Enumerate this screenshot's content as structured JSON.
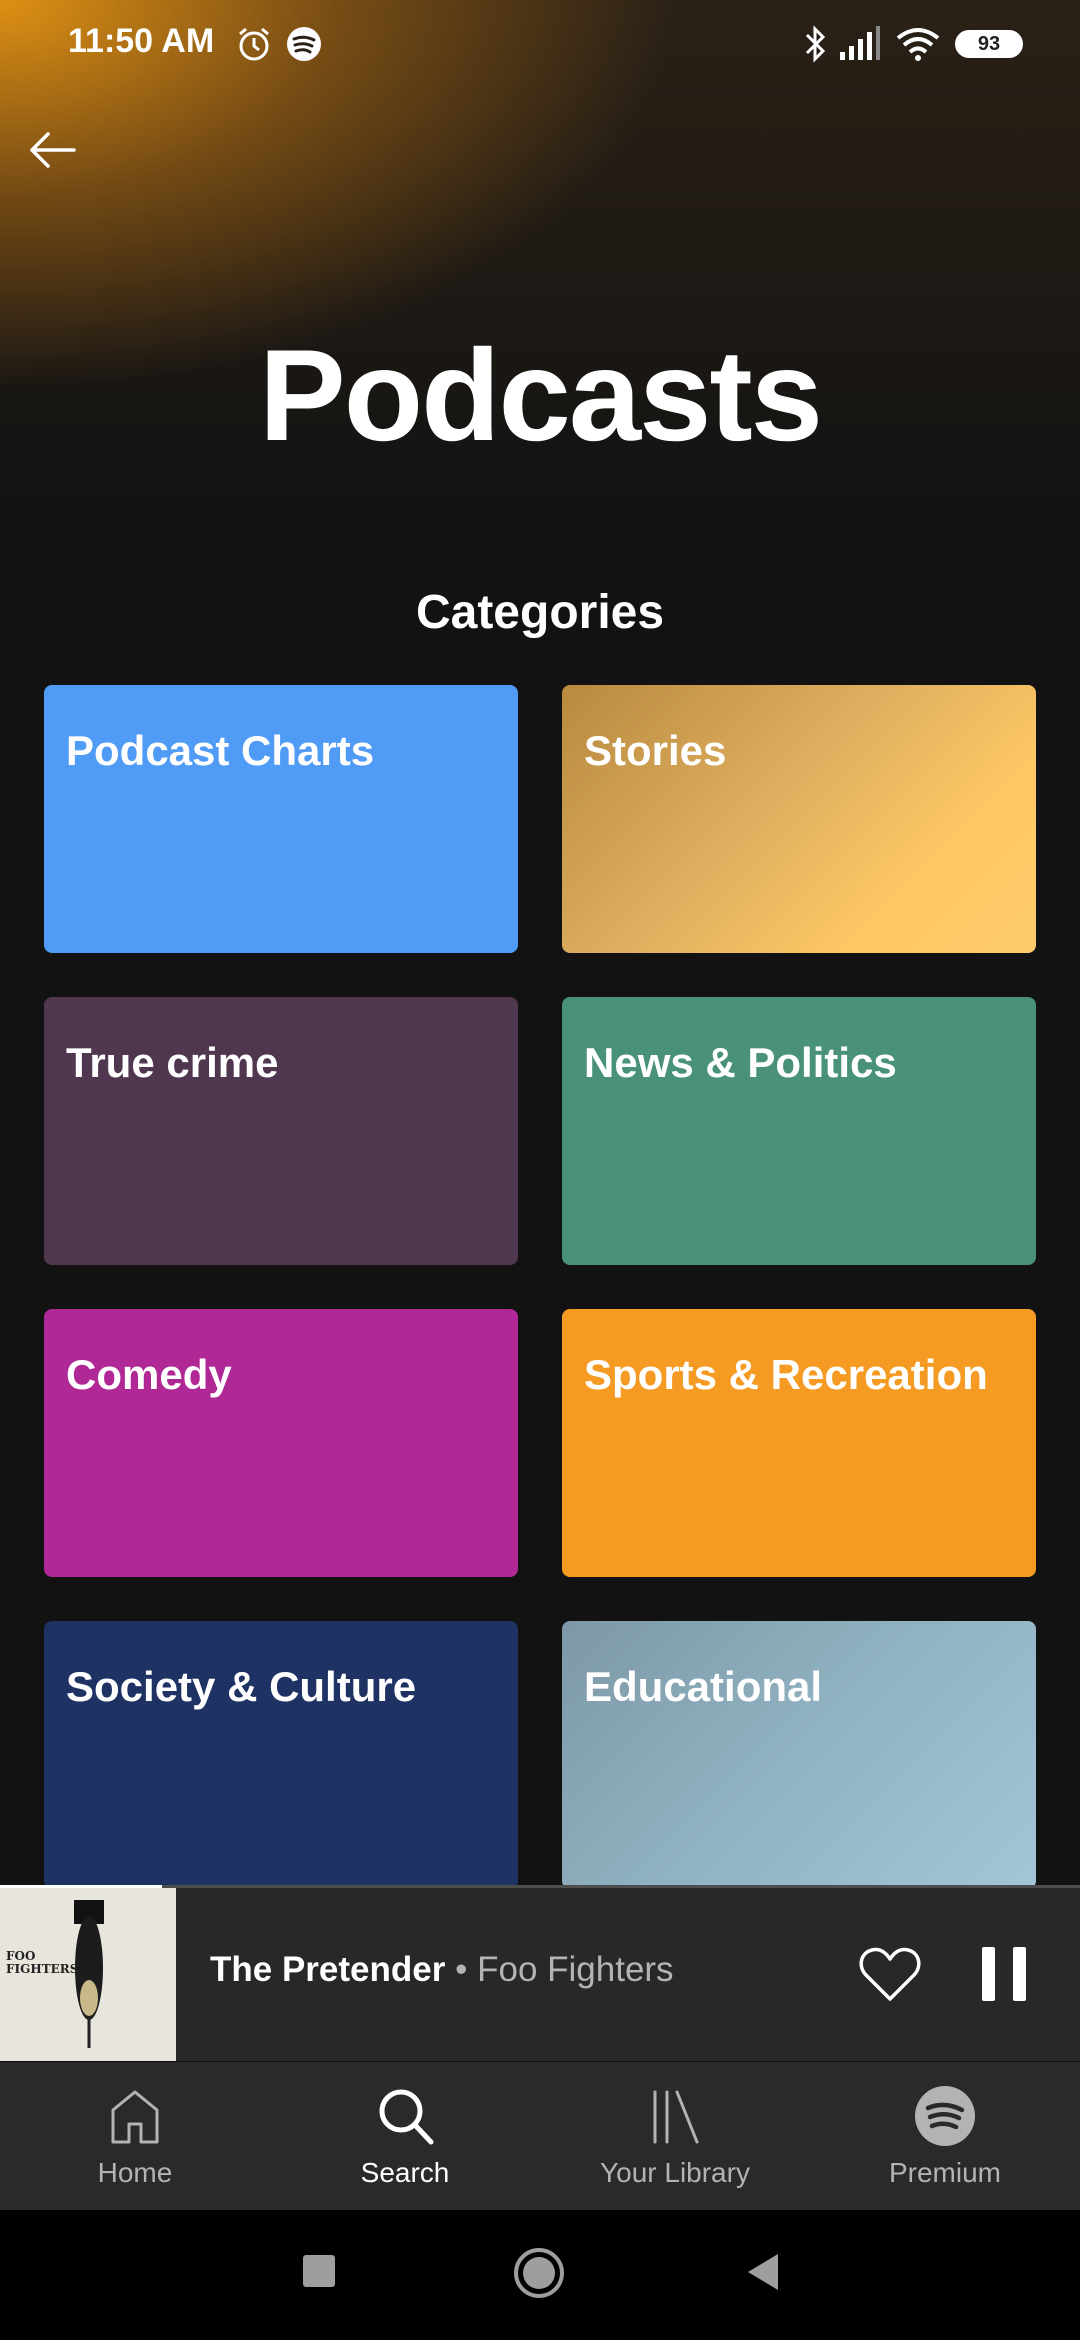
{
  "status_bar": {
    "time": "11:50 AM",
    "battery": "93",
    "icons": [
      "alarm-icon",
      "spotify-icon",
      "bluetooth-icon",
      "signal-icon",
      "wifi-icon"
    ]
  },
  "header": {
    "title": "Podcasts",
    "back_icon": "back-arrow-icon",
    "gradient_color": "#e8961a"
  },
  "categories": {
    "title": "Categories",
    "items": [
      {
        "label": "Podcast Charts",
        "color": "#509bf5"
      },
      {
        "label": "Stories",
        "color": "#ffc864"
      },
      {
        "label": "True crime",
        "color": "#503750"
      },
      {
        "label": "News & Politics",
        "color": "#4a917c"
      },
      {
        "label": "Comedy",
        "color": "#af2896"
      },
      {
        "label": "Sports & Recreation",
        "color": "#f59b23"
      },
      {
        "label": "Society & Culture",
        "color": "#1e3264"
      },
      {
        "label": "Educational",
        "color": "#9cc1d6"
      }
    ]
  },
  "now_playing": {
    "title": "The Pretender",
    "separator": "•",
    "artist": "Foo Fighters",
    "album_art_text": "FOO FIGHTERS",
    "progress": 0.15,
    "liked": false,
    "playing": true
  },
  "bottom_nav": {
    "active": "Search",
    "items": [
      {
        "label": "Home",
        "icon": "home-icon"
      },
      {
        "label": "Search",
        "icon": "search-icon"
      },
      {
        "label": "Your Library",
        "icon": "library-icon"
      },
      {
        "label": "Premium",
        "icon": "spotify-premium-icon"
      }
    ]
  },
  "system_nav": {
    "icons": [
      "recents-square-icon",
      "home-circle-icon",
      "back-triangle-icon"
    ]
  }
}
